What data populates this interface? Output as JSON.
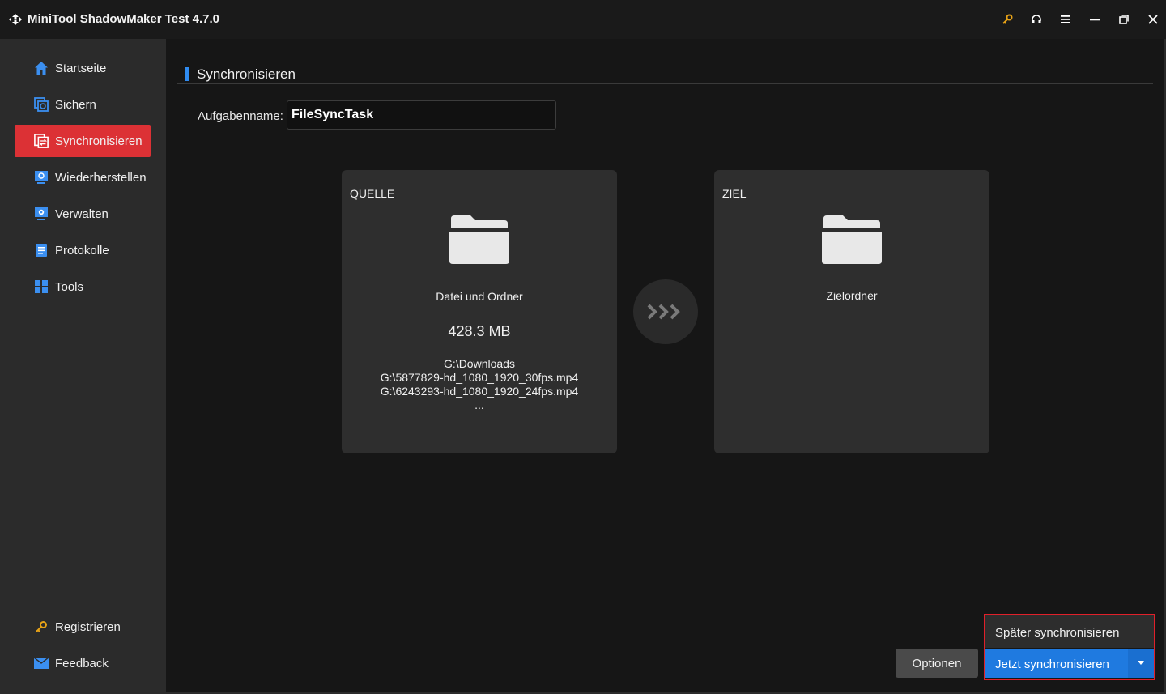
{
  "window": {
    "title": "MiniTool ShadowMaker Test 4.7.0",
    "controls": [
      "key-icon",
      "headset-icon",
      "menu-icon",
      "minimize-icon",
      "restore-icon",
      "close-icon"
    ]
  },
  "sidebar": {
    "items": [
      {
        "label": "Startseite",
        "icon": "home-icon"
      },
      {
        "label": "Sichern",
        "icon": "backup-icon"
      },
      {
        "label": "Synchronisieren",
        "icon": "sync-icon",
        "active": true
      },
      {
        "label": "Wiederherstellen",
        "icon": "restore-icon"
      },
      {
        "label": "Verwalten",
        "icon": "manage-icon"
      },
      {
        "label": "Protokolle",
        "icon": "logs-icon"
      },
      {
        "label": "Tools",
        "icon": "tools-icon"
      }
    ],
    "bottom_items": [
      {
        "label": "Registrieren",
        "icon": "key-icon"
      },
      {
        "label": "Feedback",
        "icon": "mail-icon"
      }
    ]
  },
  "main": {
    "section_title": "Synchronisieren",
    "task_name_label": "Aufgabenname:",
    "task_name_value": "FileSyncTask",
    "source": {
      "heading": "QUELLE",
      "name": "Datei und Ordner",
      "size": "428.3 MB",
      "paths": [
        "G:\\Downloads",
        "G:\\5877829-hd_1080_1920_30fps.mp4",
        "G:\\6243293-hd_1080_1920_24fps.mp4",
        "..."
      ]
    },
    "destination": {
      "heading": "ZIEL",
      "name": "Zielordner"
    }
  },
  "actions": {
    "options_label": "Optionen",
    "sync_later_label": "Später synchronisieren",
    "sync_now_label": "Jetzt synchronisieren"
  },
  "colors": {
    "accent_red": "#dc3135",
    "accent_blue": "#1f7ae0",
    "highlight_border": "#e0202a"
  }
}
